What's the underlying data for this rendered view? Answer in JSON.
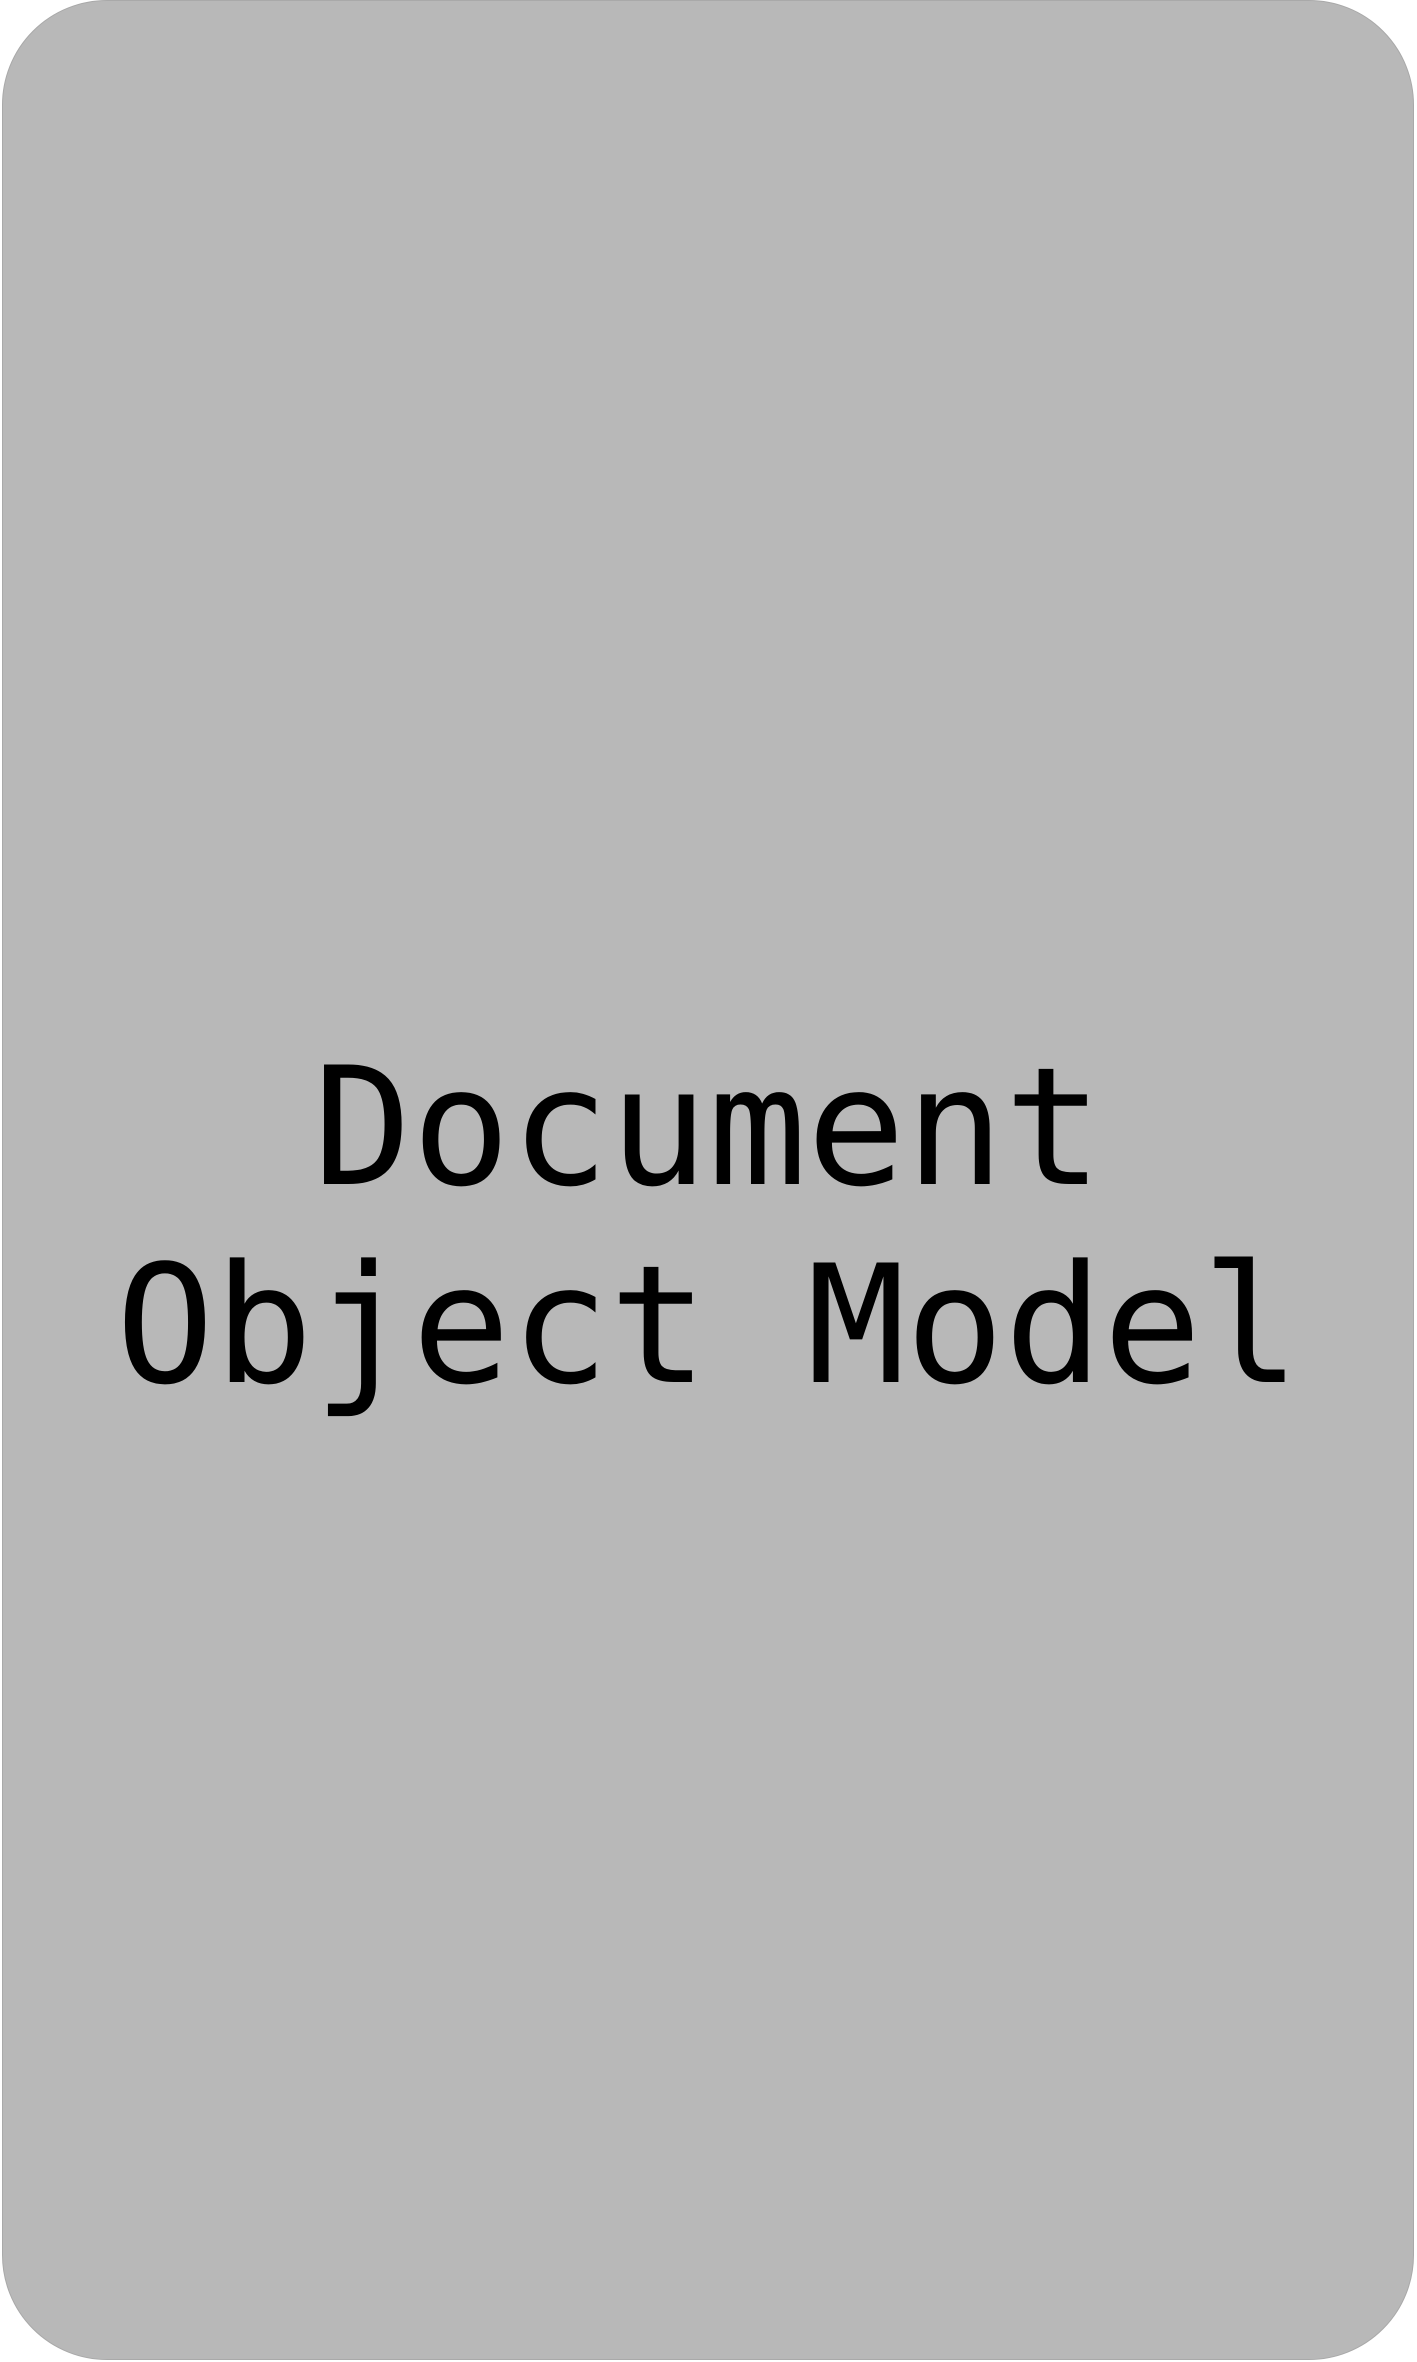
{
  "card": {
    "lines": [
      "Document",
      "Object Model"
    ]
  }
}
